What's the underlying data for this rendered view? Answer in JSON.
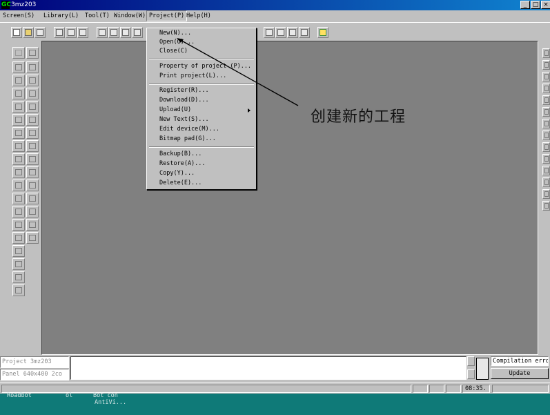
{
  "window": {
    "title": "3mz203",
    "logo_text": "GC",
    "controls": [
      "_",
      "□",
      "×"
    ]
  },
  "menubar": [
    {
      "label": "Screen(S)"
    },
    {
      "label": "Library(L)"
    },
    {
      "label": "Tool(T)"
    },
    {
      "label": "Window(W)"
    },
    {
      "label": "Project(P)"
    },
    {
      "label": "Help(H)"
    }
  ],
  "project_menu": {
    "items": [
      "New(N)...",
      "Open(O)...",
      "Close(C)",
      "Property of project (P)...",
      "Print project(L)...",
      "Register(R)...",
      "Download(D)...",
      "Upload(U)",
      "New Text(S)...",
      "Edit device(M)...",
      "Bitmap pad(G)...",
      "Backup(B)...",
      "Restore(A)...",
      "Copy(Y)...",
      "Delete(E)..."
    ],
    "submenu_item": "Upload(U)"
  },
  "annotation": {
    "text": "创建新的工程"
  },
  "bottom": {
    "project_label": "Project 3mz203",
    "panel_label": "Panel 640x400 2co",
    "compilation_label": "Compilation erro",
    "update_button": "Update"
  },
  "status": {
    "clock": "08:35."
  },
  "taskbar": {
    "items": [
      "Roadbot",
      "ol",
      "Bot con",
      "AntiVi..."
    ]
  },
  "colors": {
    "title_start": "#00007b",
    "title_end": "#1084d0",
    "face": "#c0c0c0",
    "workspace": "#808080",
    "desktop": "#0f7a78"
  }
}
